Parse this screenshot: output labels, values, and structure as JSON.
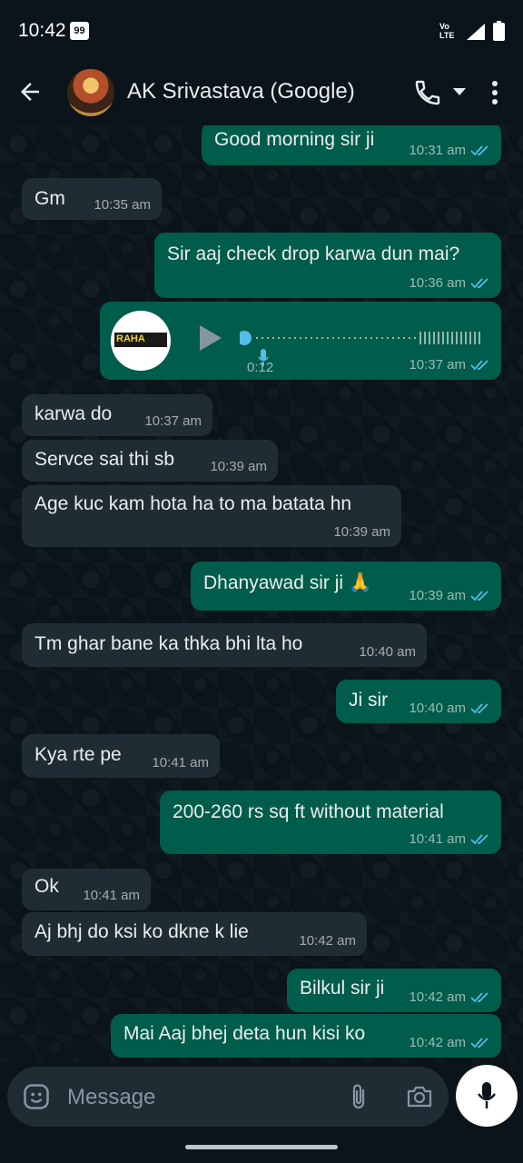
{
  "status_bar": {
    "time": "10:42",
    "badge": "99",
    "network": "Vo·LTE"
  },
  "header": {
    "contact_name": "AK Srivastava (Google)"
  },
  "voice_note": {
    "duration": "0:12",
    "time": "10:37 am",
    "thumb_label": "RAHA"
  },
  "messages": [
    {
      "dir": "out",
      "text": "Good morning sir ji",
      "time": "10:31 am"
    },
    {
      "dir": "in",
      "text": "Gm",
      "time": "10:35 am"
    },
    {
      "dir": "out",
      "text": "Sir aaj check drop karwa dun mai?",
      "time": "10:36 am"
    },
    {
      "dir": "in",
      "text": "karwa do",
      "time": "10:37 am"
    },
    {
      "dir": "in",
      "text": "Servce sai thi sb",
      "time": "10:39 am"
    },
    {
      "dir": "in",
      "text": "Age kuc kam hota ha to ma batata hn",
      "time": "10:39 am"
    },
    {
      "dir": "out",
      "text": "Dhanyawad sir ji 🙏",
      "time": "10:39 am"
    },
    {
      "dir": "in",
      "text": "Tm ghar bane ka thka bhi lta ho",
      "time": "10:40 am"
    },
    {
      "dir": "out",
      "text": "Ji sir",
      "time": "10:40 am"
    },
    {
      "dir": "in",
      "text": "Kya rte pe",
      "time": "10:41 am"
    },
    {
      "dir": "out",
      "text": "200-260 rs sq ft without material",
      "time": "10:41 am"
    },
    {
      "dir": "in",
      "text": "Ok",
      "time": "10:41 am"
    },
    {
      "dir": "in",
      "text": "Aj bhj do ksi ko dkne k lie",
      "time": "10:42 am"
    },
    {
      "dir": "out",
      "text": "Bilkul sir ji",
      "time": "10:42 am"
    },
    {
      "dir": "out",
      "text": "Mai Aaj bhej deta hun kisi ko",
      "time": "10:42 am"
    }
  ],
  "composer": {
    "placeholder": "Message"
  },
  "colors": {
    "bg": "#0b141a",
    "outgoing": "#005c4b",
    "incoming": "#202c33",
    "read_tick": "#53bdeb"
  },
  "icons": [
    "back-arrow-icon",
    "phone-icon",
    "chevron-down-icon",
    "more-vert-icon",
    "play-icon",
    "mic-icon",
    "emoji-icon",
    "attach-icon",
    "camera-icon"
  ]
}
